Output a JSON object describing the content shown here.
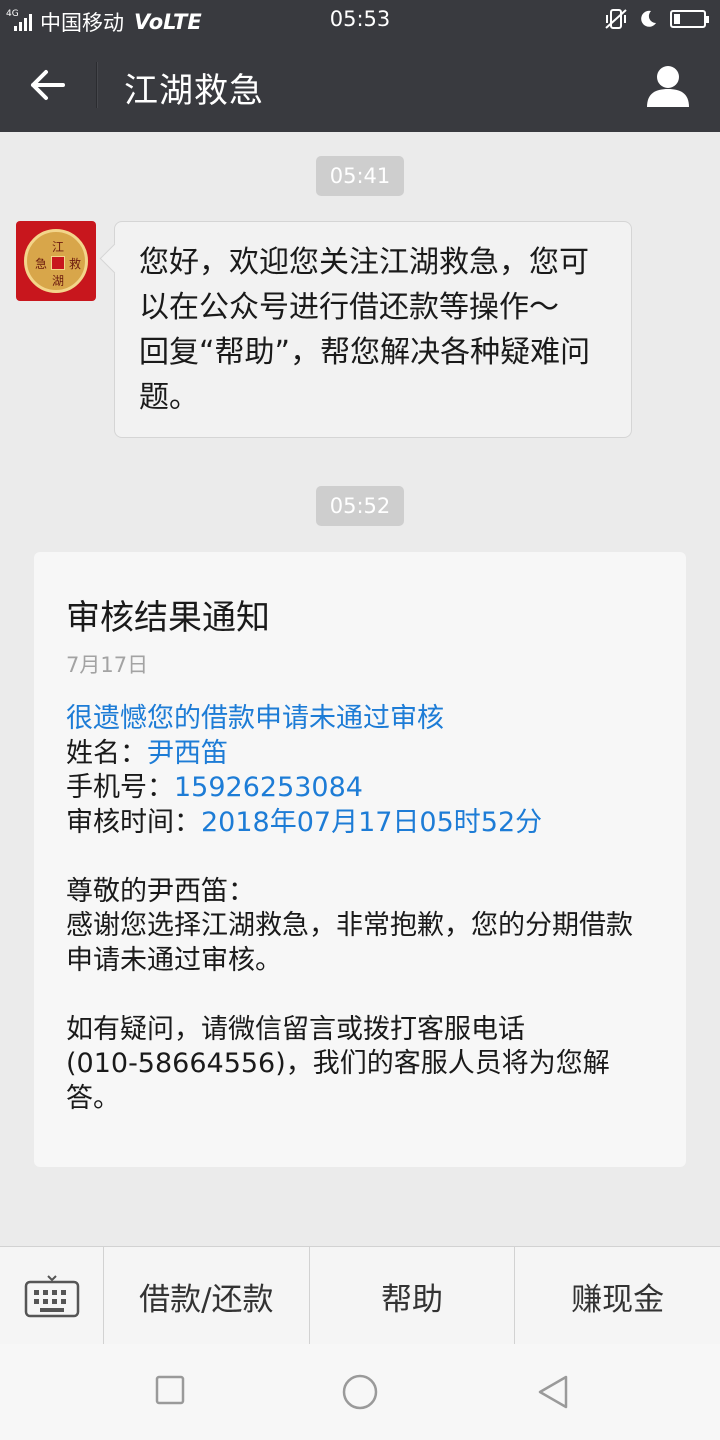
{
  "status_bar": {
    "network": "4G",
    "carrier": "中国移动",
    "volte": "VoLTE",
    "time": "05:53",
    "battery_level": 0.2
  },
  "header": {
    "title": "江湖救急"
  },
  "messages": [
    {
      "timestamp": "05:41",
      "avatar_chars": [
        "江",
        "湖",
        "救",
        "急"
      ],
      "lines": [
        "您好，欢迎您关注江湖救急，您可",
        "以在公众号进行借还款等操作～",
        "回复“帮助”，帮您解决各种疑难问",
        "题。"
      ]
    },
    {
      "timestamp": "05:52",
      "card": {
        "title": "审核结果通知",
        "date": "7月17日",
        "headline": "很遗憾您的借款申请未通过审核",
        "name_label": "姓名：",
        "name_value": "尹西笛",
        "phone_label": "手机号：",
        "phone_value": "15926253084",
        "review_time_label": "审核时间：",
        "review_time_value": "2018年07月17日05时52分",
        "greeting": "尊敬的尹西笛：",
        "para1_line1": "感谢您选择江湖救急，非常抱歉，您的分期借款",
        "para1_line2": "申请未通过审核。",
        "para2_line1": "如有疑问，请微信留言或拨打客服电话",
        "para2_line2": "(010-58664556)，我们的客服人员将为您解",
        "para2_line3": "答。"
      }
    }
  ],
  "menu": {
    "items": [
      "借款/还款",
      "帮助",
      "赚现金"
    ]
  },
  "icons": {
    "back": "arrow-left-icon",
    "profile": "person-icon",
    "keyboard": "keyboard-icon",
    "nav_recent": "square-icon",
    "nav_home": "circle-icon",
    "nav_back": "triangle-back-icon"
  },
  "colors": {
    "header_bg": "#393a3f",
    "link_blue": "#1d7cd6",
    "avatar_red": "#c8161d"
  }
}
